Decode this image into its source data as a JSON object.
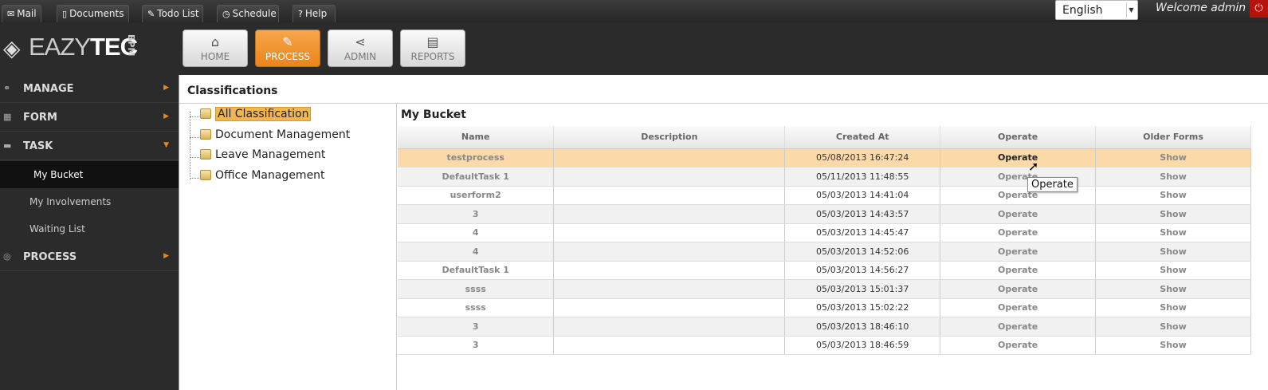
{
  "topbar": {
    "tabs": [
      {
        "label": "Mail",
        "icon": "mail-icon"
      },
      {
        "label": "Documents",
        "icon": "documents-icon"
      },
      {
        "label": "Todo List",
        "icon": "pin-icon"
      },
      {
        "label": "Schedule",
        "icon": "clock-icon"
      },
      {
        "label": "Help",
        "icon": "help-icon"
      }
    ],
    "language": "English",
    "welcome": "Welcome admin"
  },
  "logo": {
    "brand_light": "EAZY",
    "brand_bold": "TEC",
    "sub": "BPM"
  },
  "nav": [
    {
      "label": "HOME",
      "icon": "home-icon"
    },
    {
      "label": "PROCESS",
      "icon": "magic-wand-icon",
      "active": true
    },
    {
      "label": "ADMIN",
      "icon": "share-icon"
    },
    {
      "label": "REPORTS",
      "icon": "clipboard-icon"
    }
  ],
  "sidebar": {
    "manage": "MANAGE",
    "form": "FORM",
    "task": "TASK",
    "task_items": [
      "My Bucket",
      "My Involvements",
      "Waiting List"
    ],
    "process": "PROCESS"
  },
  "content": {
    "title": "Classifications",
    "tree": [
      "All Classification",
      "Document Management",
      "Leave Management",
      "Office Management"
    ],
    "bucket_title": "My Bucket",
    "columns": [
      "Name",
      "Description",
      "Created At",
      "Operate",
      "Older Forms"
    ],
    "rows": [
      {
        "name": "testprocess",
        "description": "",
        "created": "05/08/2013 16:47:24",
        "operate": "Operate",
        "older": "Show"
      },
      {
        "name": "DefaultTask 1",
        "description": "",
        "created": "05/11/2013 11:48:55",
        "operate": "Operate",
        "older": "Show"
      },
      {
        "name": "userform2",
        "description": "",
        "created": "05/03/2013 14:41:04",
        "operate": "Operate",
        "older": "Show"
      },
      {
        "name": "3",
        "description": "",
        "created": "05/03/2013 14:43:57",
        "operate": "Operate",
        "older": "Show"
      },
      {
        "name": "4",
        "description": "",
        "created": "05/03/2013 14:45:47",
        "operate": "Operate",
        "older": "Show"
      },
      {
        "name": "4",
        "description": "",
        "created": "05/03/2013 14:52:06",
        "operate": "Operate",
        "older": "Show"
      },
      {
        "name": "DefaultTask 1",
        "description": "",
        "created": "05/03/2013 14:56:27",
        "operate": "Operate",
        "older": "Show"
      },
      {
        "name": "ssss",
        "description": "",
        "created": "05/03/2013 15:01:37",
        "operate": "Operate",
        "older": "Show"
      },
      {
        "name": "ssss",
        "description": "",
        "created": "05/03/2013 15:02:22",
        "operate": "Operate",
        "older": "Show"
      },
      {
        "name": "3",
        "description": "",
        "created": "05/03/2013 18:46:10",
        "operate": "Operate",
        "older": "Show"
      },
      {
        "name": "3",
        "description": "",
        "created": "05/03/2013 18:46:59",
        "operate": "Operate",
        "older": "Show"
      }
    ],
    "tooltip": "Operate"
  },
  "colors": {
    "accent": "#e9861a",
    "highlight_row": "#fbd9a8",
    "power": "#b8120e"
  }
}
